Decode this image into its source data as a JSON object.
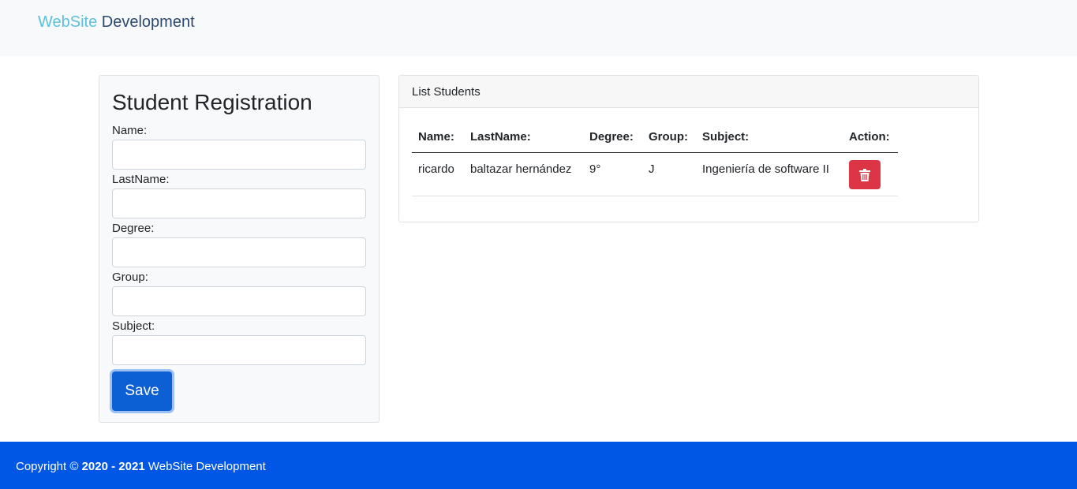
{
  "navbar": {
    "brand_part1": "WebSite",
    "brand_part2": " Development"
  },
  "registration": {
    "title": "Student Registration",
    "fields": [
      {
        "label": "Name:",
        "value": ""
      },
      {
        "label": "LastName:",
        "value": ""
      },
      {
        "label": "Degree:",
        "value": ""
      },
      {
        "label": "Group:",
        "value": ""
      },
      {
        "label": "Subject:",
        "value": ""
      }
    ],
    "save_label": "Save"
  },
  "list": {
    "title": "List Students",
    "columns": [
      "Name:",
      "LastName:",
      "Degree:",
      "Group:",
      "Subject:",
      "Action:"
    ],
    "rows": [
      {
        "name": "ricardo",
        "lastname": "baltazar hernández",
        "degree": "9°",
        "group": "J",
        "subject": "Ingeniería de software II",
        "action_icon": "trash-icon"
      }
    ]
  },
  "footer": {
    "prefix": "Copyright © ",
    "years": "2020 - 2021",
    "suffix": " WebSite Development"
  },
  "colors": {
    "brand_light": "#5bc0de",
    "brand_dark": "#2c4a6e",
    "primary": "#0d5fd4",
    "danger": "#dc3545",
    "footer_bg": "#0057e6"
  }
}
